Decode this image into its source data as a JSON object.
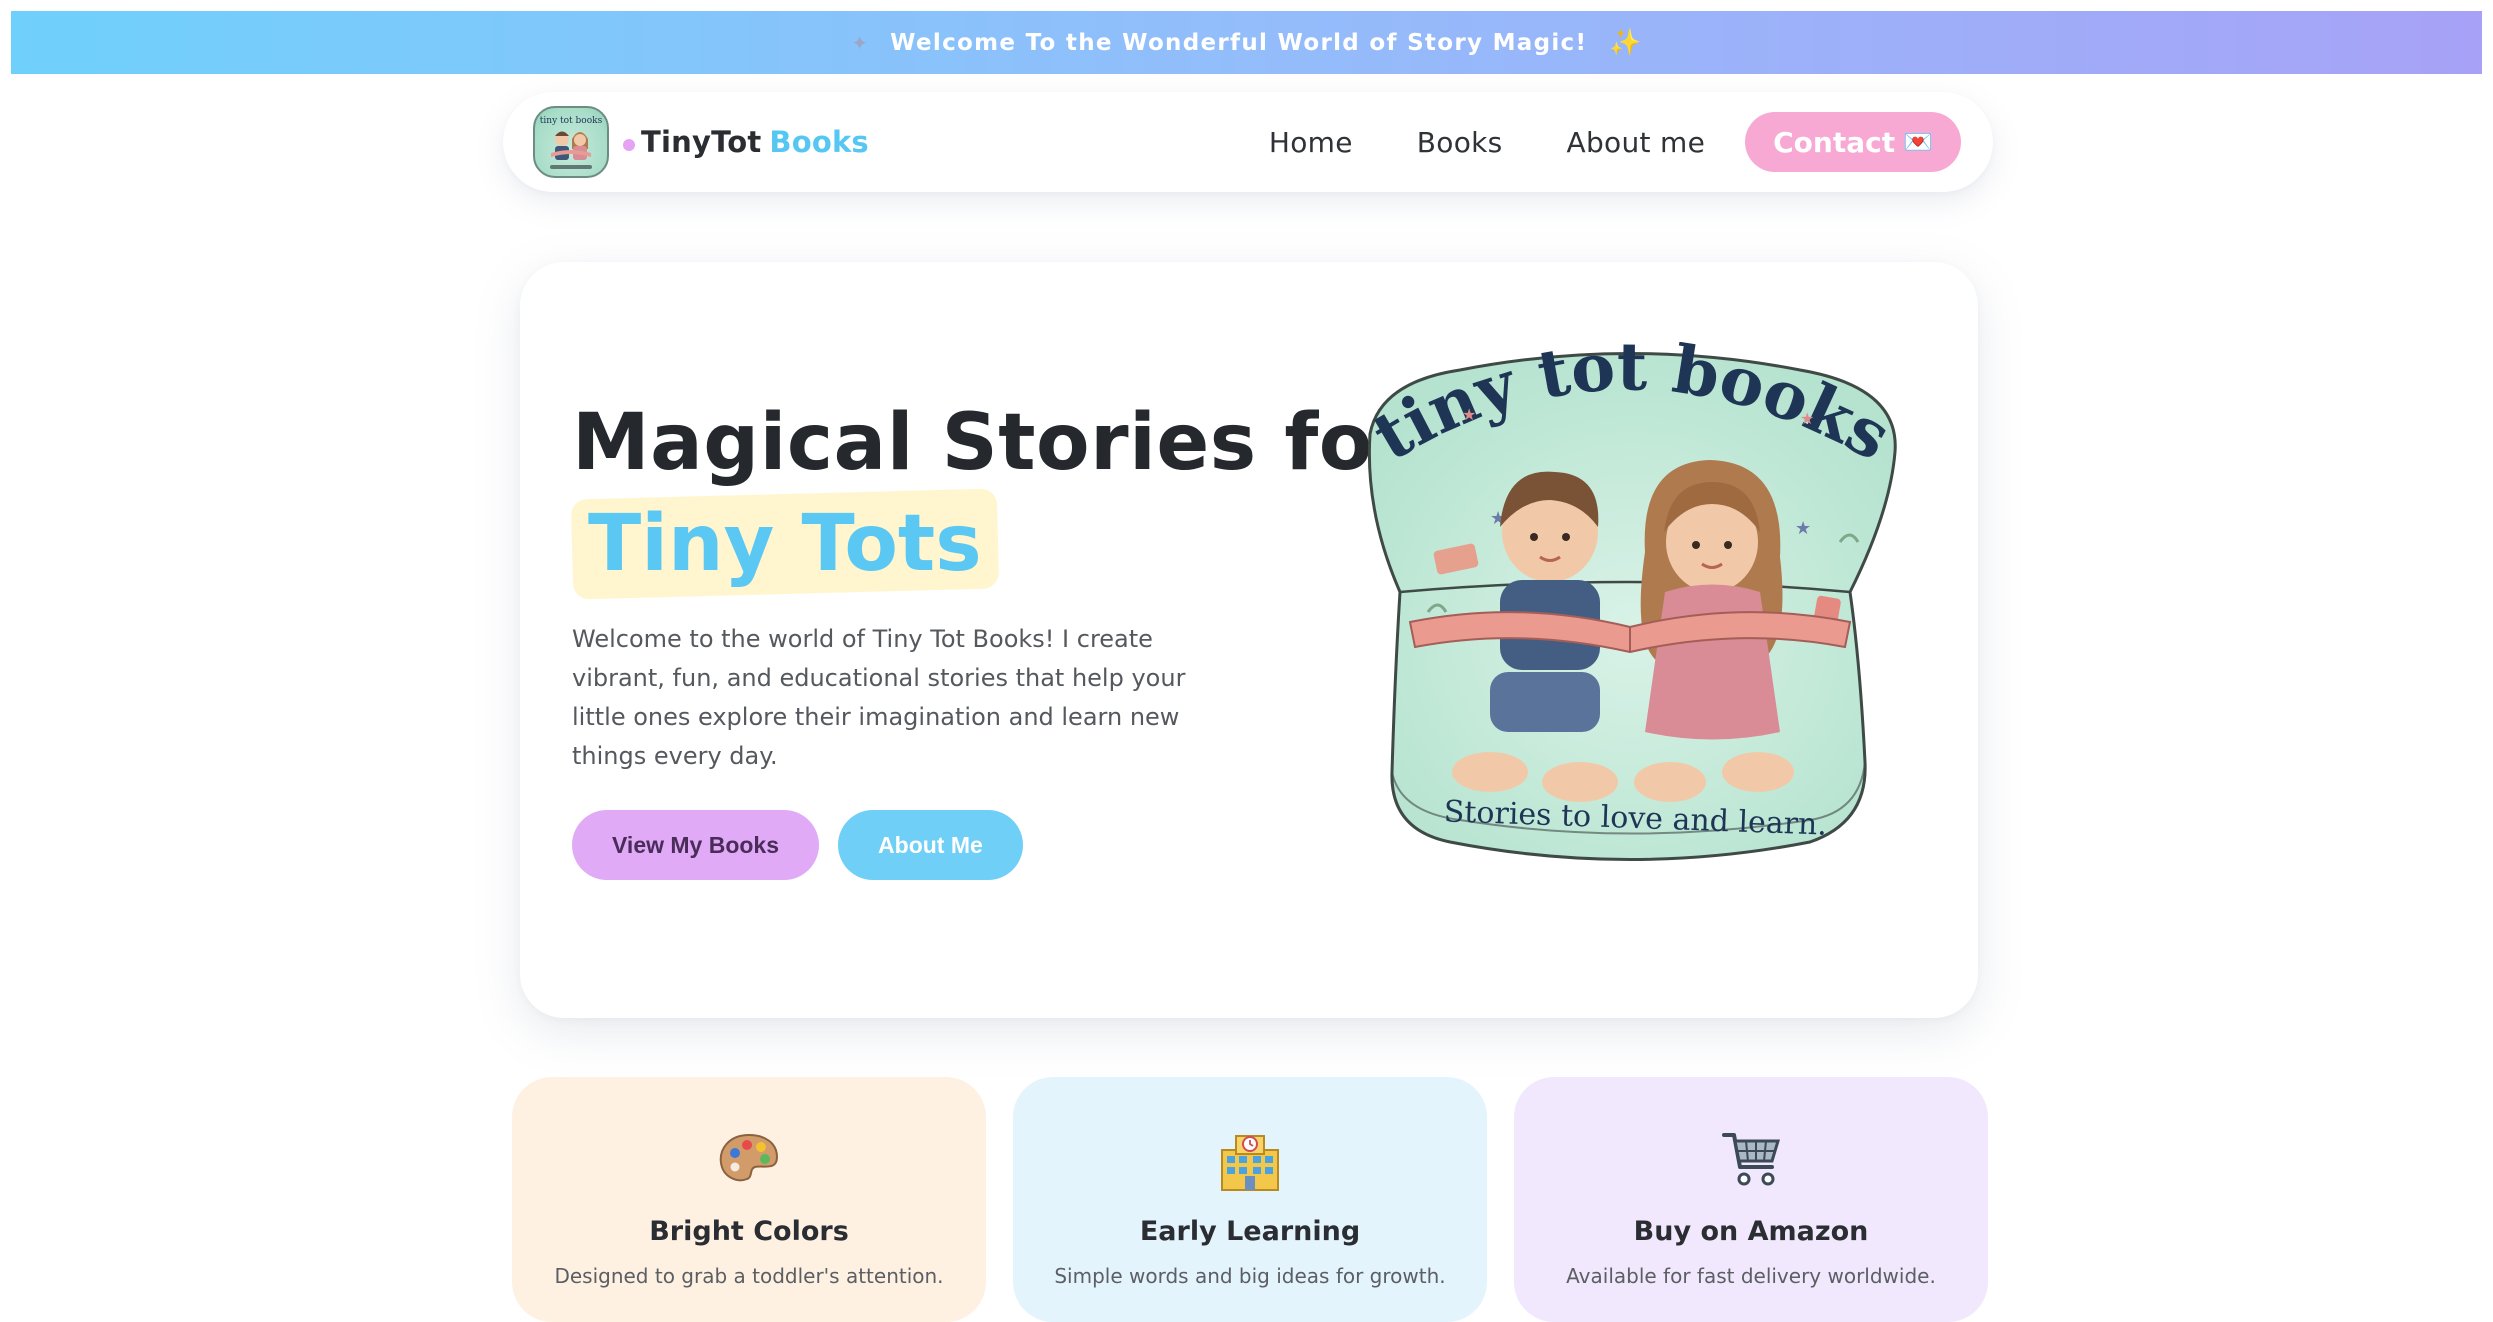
{
  "announcement": {
    "text": "Welcome To the Wonderful World of Story Magic!",
    "left_icon": "sparkle-icon",
    "right_icon": "star-icon"
  },
  "brand": {
    "name_first": "TinyTot",
    "name_second": "Books",
    "logo_text": "tiny tot books",
    "logo_subtext": "Stories to love and learn."
  },
  "nav": {
    "items": [
      {
        "label": "Home"
      },
      {
        "label": "Books"
      },
      {
        "label": "About me"
      }
    ],
    "contact_label": "Contact",
    "contact_icon": "love-letter-icon"
  },
  "hero": {
    "title_line1": "Magical Stories for",
    "title_highlight": "Tiny Tots",
    "description": "Welcome to the world of Tiny Tot Books! I create vibrant, fun, and educational stories that help your little ones explore their imagination and learn new things every day.",
    "primary_button": "View My Books",
    "secondary_button": "About Me",
    "logo_arch_text": "tiny tot books",
    "logo_tagline": "Stories to love and learn."
  },
  "features": [
    {
      "title": "Bright Colors",
      "desc": "Designed to grab a toddler's attention.",
      "icon": "palette-icon"
    },
    {
      "title": "Early Learning",
      "desc": "Simple words and big ideas for growth.",
      "icon": "school-icon"
    },
    {
      "title": "Buy on Amazon",
      "desc": "Available for fast delivery worldwide.",
      "icon": "shopping-cart-icon"
    }
  ],
  "colors": {
    "accent_blue": "#5bc8f3",
    "accent_pink": "#f7a9d3",
    "accent_purple": "#e0aaf6",
    "highlight_yellow": "#fff6cf",
    "card_peach": "#fff1e2",
    "card_sky": "#e4f4fd",
    "card_lilac": "#f2e8fd"
  }
}
